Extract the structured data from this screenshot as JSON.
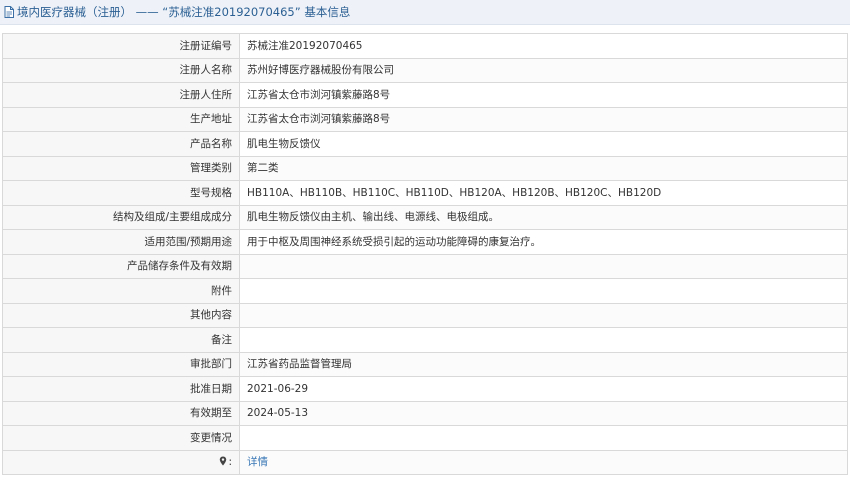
{
  "header": {
    "icon": "document-icon",
    "title": "境内医疗器械（注册） —— “苏械注准20192070465” 基本信息",
    "title_color": "#2b5f93",
    "background": "#eef2f8"
  },
  "rows": [
    {
      "label": "注册证编号",
      "value": "苏械注准20192070465"
    },
    {
      "label": "注册人名称",
      "value": "苏州好博医疗器械股份有限公司"
    },
    {
      "label": "注册人住所",
      "value": "江苏省太仓市浏河镇紫藤路8号"
    },
    {
      "label": "生产地址",
      "value": "江苏省太仓市浏河镇紫藤路8号"
    },
    {
      "label": "产品名称",
      "value": "肌电生物反馈仪"
    },
    {
      "label": "管理类别",
      "value": "第二类"
    },
    {
      "label": "型号规格",
      "value": "HB110A、HB110B、HB110C、HB110D、HB120A、HB120B、HB120C、HB120D"
    },
    {
      "label": "结构及组成/主要组成成分",
      "value": "肌电生物反馈仪由主机、输出线、电源线、电极组成。"
    },
    {
      "label": "适用范围/预期用途",
      "value": "用于中枢及周围神经系统受损引起的运动功能障碍的康复治疗。"
    },
    {
      "label": "产品储存条件及有效期",
      "value": ""
    },
    {
      "label": "附件",
      "value": ""
    },
    {
      "label": "其他内容",
      "value": ""
    },
    {
      "label": "备注",
      "value": ""
    },
    {
      "label": "审批部门",
      "value": "江苏省药品监督管理局"
    },
    {
      "label": "批准日期",
      "value": "2021-06-29"
    },
    {
      "label": "有效期至",
      "value": "2024-05-13"
    },
    {
      "label": "变更情况",
      "value": ""
    }
  ],
  "detail_row": {
    "icon": "pin-icon",
    "link_text": "详情",
    "link_color": "#3a78b6"
  }
}
